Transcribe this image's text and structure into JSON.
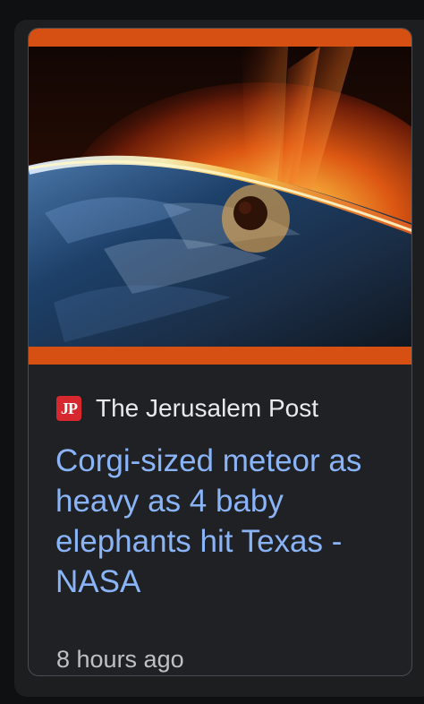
{
  "card": {
    "source_logo_text": "JP",
    "source_name": "The Jerusalem Post",
    "headline": "Corgi-sized meteor as heavy as 4 baby elephants hit Texas - NASA",
    "timestamp": "8 hours ago"
  },
  "colors": {
    "accent_bar": "#d65014",
    "logo_background": "#d7282f",
    "headline_link": "#8ab4f8",
    "card_background": "#202124"
  },
  "icons": {
    "source_logo": "jerusalem-post-logo-icon"
  }
}
